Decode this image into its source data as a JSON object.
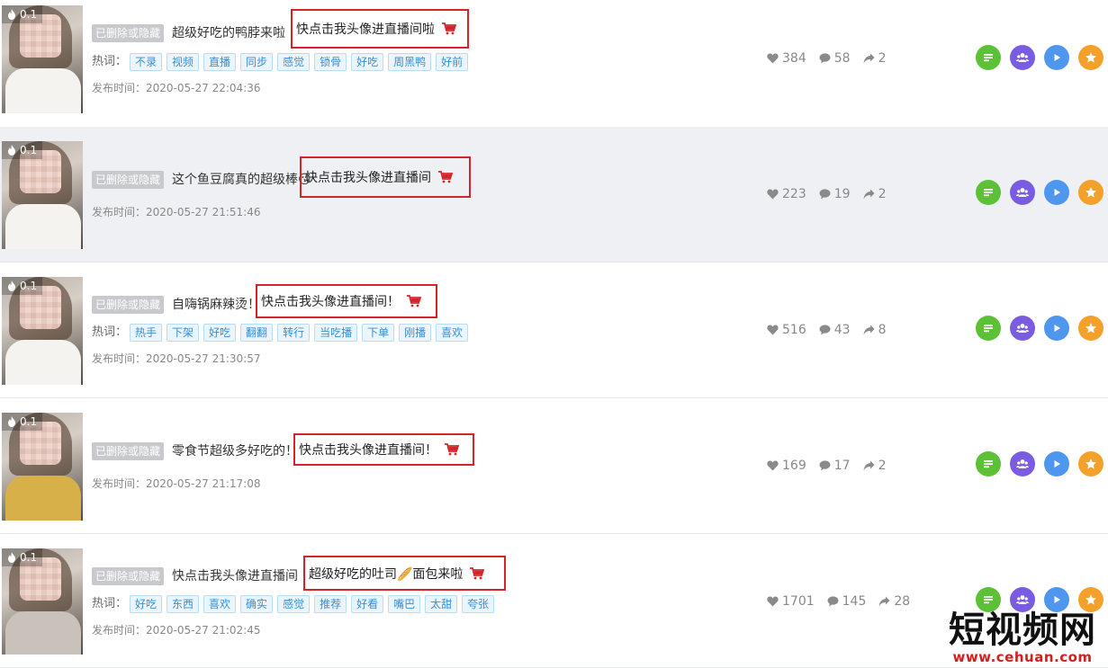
{
  "deleted_label": "已删除或隐藏",
  "hot_label": "热词：",
  "pubtime_prefix": "发布时间：",
  "thumb_badge": "0.1",
  "colors": {
    "accent_red": "#d4242a",
    "tag_blue": "#3a8fd6",
    "green": "#5cc136",
    "purple": "#7a5ce0",
    "blue": "#4f96ef",
    "orange": "#f4a12b"
  },
  "action_icons": [
    "list-icon",
    "users-icon",
    "play-icon",
    "star-icon"
  ],
  "rows": [
    {
      "title_plain": "超级好吃的鸭脖来啦",
      "title_boxed": "快点击我头像进直播间啦",
      "tags": [
        "不录",
        "视频",
        "直播",
        "同步",
        "感觉",
        "锁骨",
        "好吃",
        "周黑鸭",
        "好前"
      ],
      "pubtime": "2020-05-27 22:04:36",
      "likes": "384",
      "comments": "58",
      "shares": "2"
    },
    {
      "title_plain": "这个鱼豆腐真的超级棒😘",
      "title_boxed": "快点击我头像进直播间",
      "tags": [],
      "pubtime": "2020-05-27 21:51:46",
      "likes": "223",
      "comments": "19",
      "shares": "2"
    },
    {
      "title_plain": "自嗨锅麻辣烫！",
      "title_boxed": "快点击我头像进直播间！",
      "tags": [
        "热手",
        "下架",
        "好吃",
        "翻翻",
        "转行",
        "当吃播",
        "下单",
        "刚播",
        "喜欢"
      ],
      "pubtime": "2020-05-27 21:30:57",
      "likes": "516",
      "comments": "43",
      "shares": "8"
    },
    {
      "title_plain": "零食节超级多好吃的！",
      "title_boxed": "快点击我头像进直播间！",
      "tags": [],
      "pubtime": "2020-05-27 21:17:08",
      "likes": "169",
      "comments": "17",
      "shares": "2"
    },
    {
      "title_plain": "快点击我头像进直播间",
      "title_boxed": "超级好吃的吐司🥖面包来啦",
      "tags": [
        "好吃",
        "东西",
        "喜欢",
        "确实",
        "感觉",
        "推荐",
        "好看",
        "嘴巴",
        "太甜",
        "夸张"
      ],
      "pubtime": "2020-05-27 21:02:45",
      "likes": "1701",
      "comments": "145",
      "shares": "28"
    }
  ],
  "watermark": {
    "big": "短视频网",
    "url": "www.cehuan.com"
  }
}
